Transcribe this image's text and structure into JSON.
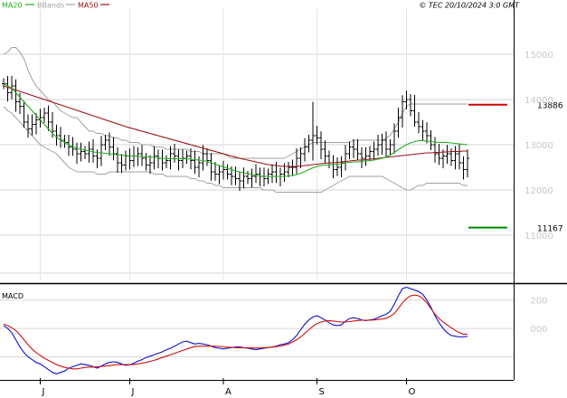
{
  "header": {
    "legend": [
      {
        "label": "MA20",
        "color": "#22aa22"
      },
      {
        "label": "BBands",
        "color": "#a0a0a0"
      },
      {
        "label": "MA50",
        "color": "#991111"
      }
    ],
    "copyright": "© TEC 20/10/2024 3:0 GMT"
  },
  "chart_data": [
    {
      "type": "ohlc",
      "panel": "price",
      "ylim": [
        10000,
        16000
      ],
      "yticks": [
        {
          "value": 15000,
          "label": "15000"
        },
        {
          "value": 14000,
          "label": "14000"
        },
        {
          "value": 13000,
          "label": "13000"
        },
        {
          "value": 12000,
          "label": "12000"
        },
        {
          "value": 11000,
          "label": "11000"
        }
      ],
      "xticks": [
        {
          "index": 9,
          "label": "J"
        },
        {
          "index": 31,
          "label": "J"
        },
        {
          "index": 54,
          "label": "A"
        },
        {
          "index": 77,
          "label": "S"
        },
        {
          "index": 99,
          "label": "O"
        }
      ],
      "levels": [
        {
          "value": 13886,
          "label": "13886",
          "color": "#cc0000"
        },
        {
          "value": 11167,
          "label": "11167",
          "color": "#008800"
        }
      ],
      "close": [
        14350,
        14150,
        14300,
        13950,
        13850,
        13500,
        13350,
        13450,
        13550,
        13600,
        13700,
        13500,
        13300,
        13200,
        13100,
        13050,
        12950,
        12900,
        12800,
        12850,
        12800,
        12900,
        12750,
        12700,
        13000,
        13100,
        12950,
        12800,
        12600,
        12550,
        12750,
        12650,
        12750,
        12800,
        12700,
        12550,
        12600,
        12750,
        12700,
        12600,
        12650,
        12800,
        12750,
        12650,
        12700,
        12750,
        12650,
        12500,
        12600,
        12800,
        12650,
        12400,
        12350,
        12400,
        12450,
        12350,
        12300,
        12250,
        12200,
        12300,
        12250,
        12300,
        12350,
        12300,
        12250,
        12350,
        12400,
        12300,
        12350,
        12400,
        12500,
        12500,
        12700,
        12800,
        12950,
        13100,
        13200,
        13150,
        12900,
        12750,
        12600,
        12450,
        12500,
        12600,
        12800,
        12950,
        12900,
        12800,
        12700,
        12750,
        12850,
        12900,
        13000,
        13100,
        12900,
        13000,
        13300,
        13600,
        13950,
        14000,
        13750,
        13500,
        13400,
        13300,
        13200,
        13000,
        12800,
        12700,
        12750,
        12800,
        12650,
        12800,
        12600,
        12450,
        12700
      ],
      "spikes": [
        {
          "index": 76,
          "high": 13950,
          "low": 12650
        },
        {
          "index": 101,
          "high": 14100,
          "low": 13400
        }
      ],
      "bbands": {
        "upper": [
          15000,
          15050,
          15150,
          15150,
          15050,
          14900,
          14650,
          14450,
          14300,
          14200,
          14100,
          14000,
          13950,
          13850,
          13750,
          13700,
          13650,
          13600,
          13600,
          13500,
          13400,
          13300,
          13300,
          13250,
          13250,
          13200,
          13200,
          13150,
          13150,
          13100,
          13100,
          13050,
          13050,
          13050,
          13000,
          13000,
          13000,
          12950,
          12950,
          12950,
          12900,
          12900,
          12900,
          12900,
          12900,
          12900,
          12850,
          12850,
          12850,
          12800,
          12800,
          12800,
          12800,
          12800,
          12800,
          12750,
          12700,
          12700,
          12700,
          12700,
          12700,
          12700,
          12700,
          12700,
          12700,
          12700,
          12700,
          12700,
          12700,
          12700,
          12750,
          12800,
          12850,
          12900,
          12950,
          13000,
          13050,
          13050,
          13050,
          13050,
          13050,
          13050,
          13050,
          13050,
          13050,
          13050,
          13100,
          13100,
          13100,
          13100,
          13100,
          13100,
          13100,
          13100,
          13150,
          13200,
          13350,
          13500,
          13700,
          13850,
          13900,
          13900,
          13900,
          13900,
          13900,
          13900,
          13900,
          13900,
          13900,
          13900,
          13900,
          13900,
          13900,
          13900,
          13900
        ],
        "lower": [
          13850,
          13750,
          13700,
          13600,
          13500,
          13400,
          13300,
          13200,
          13100,
          13000,
          12950,
          12900,
          12850,
          12800,
          12700,
          12600,
          12500,
          12450,
          12400,
          12400,
          12400,
          12400,
          12400,
          12350,
          12350,
          12350,
          12400,
          12400,
          12400,
          12400,
          12400,
          12400,
          12400,
          12400,
          12400,
          12400,
          12400,
          12350,
          12350,
          12350,
          12300,
          12300,
          12300,
          12300,
          12300,
          12300,
          12250,
          12250,
          12200,
          12200,
          12150,
          12150,
          12100,
          12100,
          12050,
          12050,
          12050,
          12050,
          12050,
          12050,
          12050,
          12050,
          12050,
          12050,
          12000,
          12000,
          12000,
          11950,
          11950,
          11950,
          11950,
          11950,
          11950,
          11950,
          11950,
          11950,
          11950,
          11950,
          11950,
          12000,
          12050,
          12100,
          12150,
          12200,
          12250,
          12300,
          12300,
          12300,
          12300,
          12300,
          12300,
          12300,
          12300,
          12300,
          12250,
          12200,
          12150,
          12100,
          12050,
          12000,
          12000,
          12050,
          12100,
          12100,
          12150,
          12150,
          12150,
          12150,
          12150,
          12150,
          12150,
          12150,
          12150,
          12100,
          12100
        ]
      },
      "ma20": [
        14350,
        14300,
        14250,
        14150,
        14050,
        13950,
        13850,
        13750,
        13650,
        13550,
        13450,
        13350,
        13250,
        13170,
        13100,
        13050,
        13000,
        12960,
        12920,
        12900,
        12880,
        12860,
        12840,
        12830,
        12820,
        12810,
        12800,
        12790,
        12780,
        12770,
        12760,
        12755,
        12750,
        12745,
        12740,
        12735,
        12730,
        12720,
        12710,
        12700,
        12690,
        12690,
        12690,
        12690,
        12690,
        12690,
        12680,
        12670,
        12660,
        12650,
        12630,
        12600,
        12570,
        12540,
        12510,
        12480,
        12450,
        12420,
        12400,
        12380,
        12360,
        12340,
        12320,
        12310,
        12300,
        12300,
        12300,
        12300,
        12300,
        12300,
        12310,
        12320,
        12340,
        12370,
        12410,
        12450,
        12490,
        12520,
        12540,
        12550,
        12560,
        12560,
        12570,
        12580,
        12600,
        12610,
        12620,
        12620,
        12630,
        12640,
        12650,
        12660,
        12680,
        12700,
        12730,
        12770,
        12830,
        12890,
        12950,
        13000,
        13040,
        13070,
        13090,
        13090,
        13080,
        13070,
        13060,
        13050,
        13050,
        13050,
        13040,
        13030,
        13020,
        13010,
        13000
      ],
      "ma50": [
        14300,
        14270,
        14240,
        14210,
        14180,
        14150,
        14120,
        14090,
        14060,
        14030,
        14000,
        13970,
        13940,
        13910,
        13880,
        13850,
        13820,
        13790,
        13760,
        13730,
        13700,
        13670,
        13640,
        13610,
        13580,
        13550,
        13520,
        13490,
        13460,
        13430,
        13400,
        13375,
        13350,
        13325,
        13300,
        13275,
        13250,
        13225,
        13200,
        13175,
        13150,
        13125,
        13100,
        13075,
        13050,
        13025,
        13000,
        12975,
        12950,
        12925,
        12900,
        12875,
        12850,
        12825,
        12800,
        12775,
        12750,
        12725,
        12700,
        12680,
        12660,
        12640,
        12620,
        12600,
        12580,
        12560,
        12550,
        12540,
        12530,
        12520,
        12520,
        12520,
        12520,
        12530,
        12540,
        12550,
        12560,
        12570,
        12580,
        12590,
        12600,
        12600,
        12610,
        12620,
        12630,
        12640,
        12650,
        12660,
        12660,
        12670,
        12680,
        12690,
        12700,
        12710,
        12720,
        12730,
        12740,
        12750,
        12760,
        12770,
        12780,
        12790,
        12800,
        12810,
        12820,
        12820,
        12830,
        12830,
        12840,
        12840,
        12850,
        12850,
        12850,
        12860,
        12860
      ]
    },
    {
      "type": "line",
      "panel": "macd",
      "title": "MACD",
      "ylim": [
        -350,
        300
      ],
      "yticks": [
        {
          "value": 200,
          "label": "200"
        },
        {
          "value": 0,
          "label": "000"
        }
      ],
      "series": [
        {
          "color": "#1111cc",
          "values": [
            20,
            0,
            -30,
            -80,
            -130,
            -170,
            -200,
            -220,
            -240,
            -250,
            -270,
            -290,
            -310,
            -320,
            -310,
            -300,
            -280,
            -270,
            -260,
            -250,
            -255,
            -260,
            -270,
            -280,
            -265,
            -250,
            -240,
            -235,
            -240,
            -250,
            -260,
            -255,
            -245,
            -230,
            -220,
            -205,
            -195,
            -185,
            -175,
            -165,
            -150,
            -140,
            -125,
            -110,
            -95,
            -90,
            -100,
            -110,
            -105,
            -110,
            -115,
            -125,
            -135,
            -140,
            -145,
            -140,
            -135,
            -130,
            -130,
            -135,
            -140,
            -145,
            -150,
            -145,
            -140,
            -135,
            -130,
            -125,
            -115,
            -110,
            -100,
            -80,
            -50,
            -10,
            30,
            60,
            80,
            90,
            75,
            60,
            40,
            25,
            20,
            25,
            50,
            70,
            75,
            70,
            60,
            55,
            60,
            65,
            75,
            90,
            100,
            120,
            170,
            230,
            280,
            290,
            280,
            270,
            260,
            240,
            200,
            150,
            90,
            40,
            0,
            -30,
            -50,
            -55,
            -60,
            -60,
            -55
          ]
        },
        {
          "color": "#cc1111",
          "values": [
            30,
            20,
            5,
            -15,
            -45,
            -80,
            -115,
            -145,
            -170,
            -190,
            -210,
            -225,
            -240,
            -255,
            -265,
            -275,
            -280,
            -285,
            -285,
            -280,
            -275,
            -272,
            -272,
            -270,
            -268,
            -265,
            -262,
            -258,
            -255,
            -255,
            -255,
            -255,
            -255,
            -250,
            -245,
            -240,
            -232,
            -225,
            -215,
            -205,
            -195,
            -185,
            -175,
            -165,
            -155,
            -145,
            -135,
            -128,
            -125,
            -125,
            -125,
            -125,
            -125,
            -127,
            -130,
            -132,
            -134,
            -135,
            -136,
            -137,
            -137,
            -138,
            -138,
            -138,
            -136,
            -134,
            -132,
            -128,
            -124,
            -118,
            -110,
            -95,
            -80,
            -60,
            -35,
            -10,
            15,
            35,
            45,
            52,
            55,
            52,
            48,
            45,
            45,
            48,
            52,
            56,
            58,
            58,
            58,
            60,
            62,
            66,
            72,
            85,
            105,
            140,
            180,
            210,
            230,
            235,
            230,
            210,
            180,
            140,
            100,
            70,
            45,
            25,
            5,
            -15,
            -30,
            -40,
            -40
          ]
        }
      ]
    }
  ]
}
